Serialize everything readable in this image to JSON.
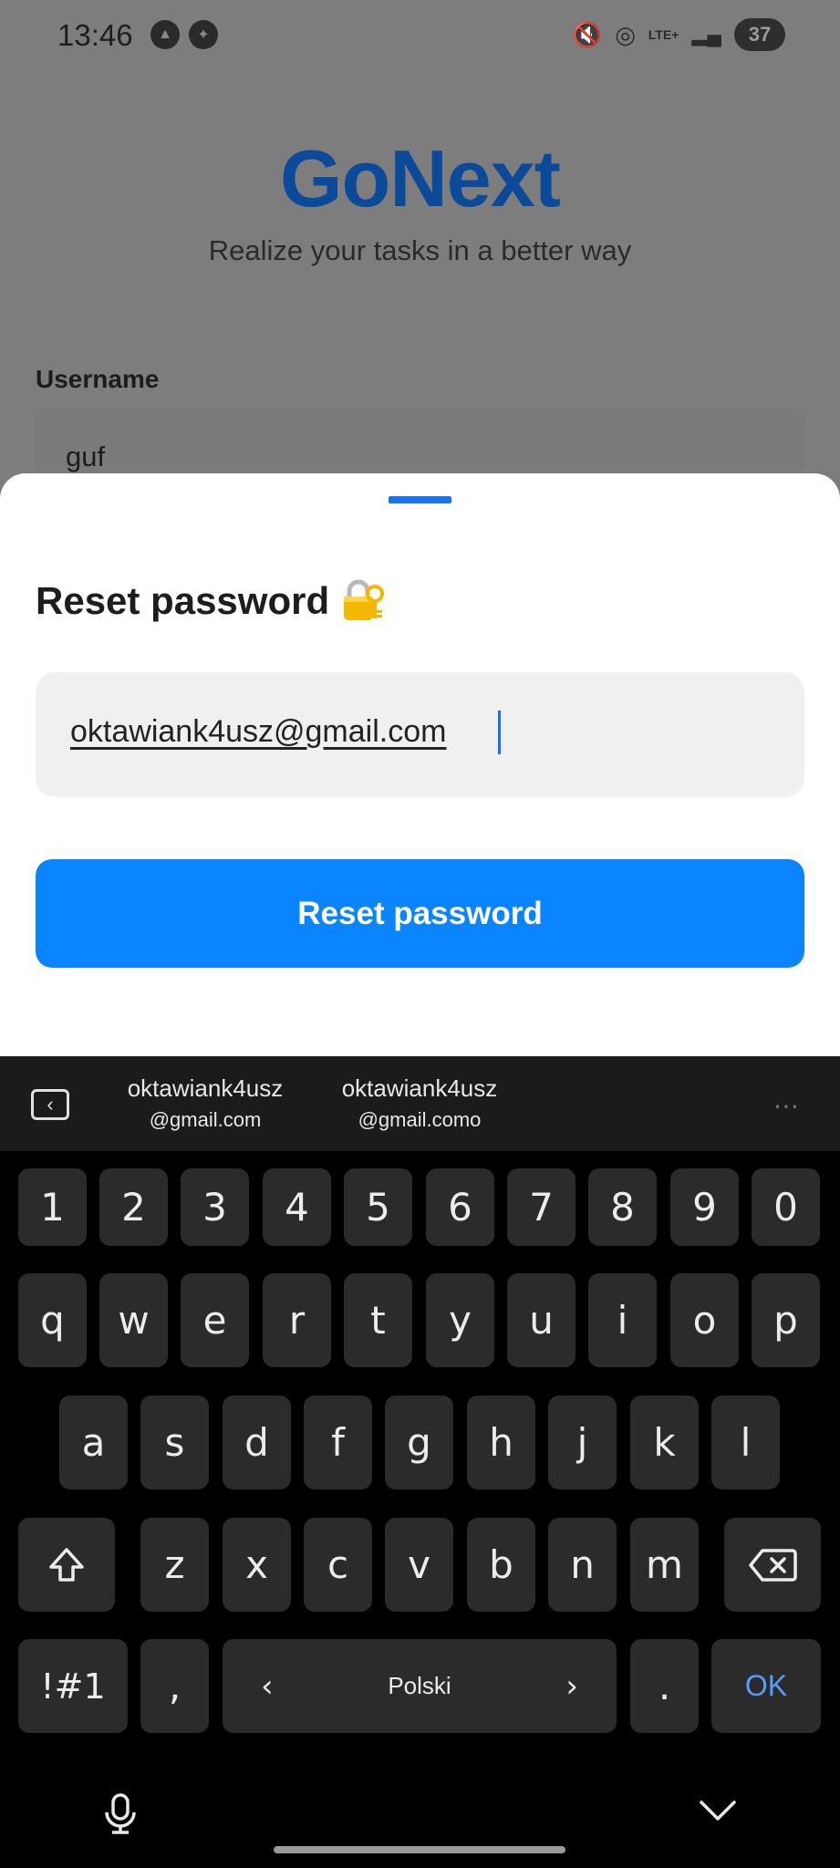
{
  "status_bar": {
    "time": "13:46",
    "battery": "37",
    "network": "LTE+"
  },
  "app": {
    "brand": "GoNext",
    "tagline": "Realize your tasks in a better way",
    "username_label": "Username",
    "username_value": "guf"
  },
  "sheet": {
    "title": "Reset password",
    "email_value": "oktawiank4usz@gmail.com",
    "button_label": "Reset password",
    "accent_color": "#0a84ff"
  },
  "keyboard": {
    "suggestions": [
      {
        "line1": "oktawiank4usz",
        "line2": "@gmail.com"
      },
      {
        "line1": "oktawiank4usz",
        "line2": "@gmail.como"
      }
    ],
    "row_numbers": [
      "1",
      "2",
      "3",
      "4",
      "5",
      "6",
      "7",
      "8",
      "9",
      "0"
    ],
    "row_q": [
      "q",
      "w",
      "e",
      "r",
      "t",
      "y",
      "u",
      "i",
      "o",
      "p"
    ],
    "row_a": [
      "a",
      "s",
      "d",
      "f",
      "g",
      "h",
      "j",
      "k",
      "l"
    ],
    "row_z": [
      "z",
      "x",
      "c",
      "v",
      "b",
      "n",
      "m"
    ],
    "symbols_key": "!#1",
    "comma_key": ",",
    "space_label": "Polski",
    "period_key": ".",
    "ok_key": "OK"
  }
}
